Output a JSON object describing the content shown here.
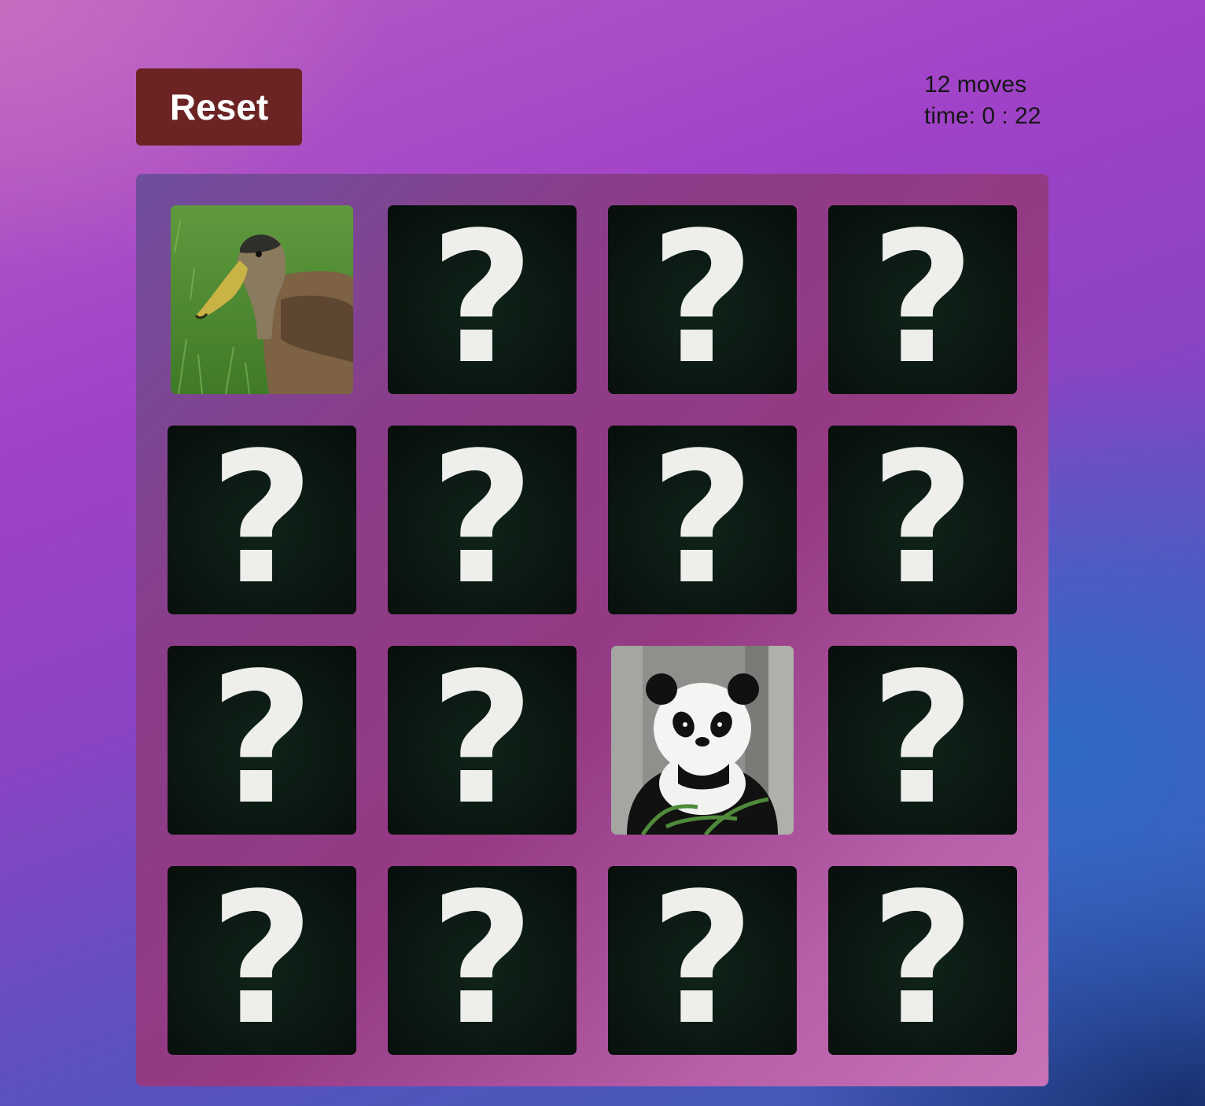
{
  "toolbar": {
    "reset_label": "Reset"
  },
  "stats": {
    "moves": "12 moves",
    "time": "time: 0 : 22"
  },
  "back_glyph": "?",
  "cards": [
    {
      "state": "open",
      "picture": "duck"
    },
    {
      "state": "closed"
    },
    {
      "state": "closed"
    },
    {
      "state": "closed"
    },
    {
      "state": "closed"
    },
    {
      "state": "closed"
    },
    {
      "state": "closed"
    },
    {
      "state": "closed"
    },
    {
      "state": "closed"
    },
    {
      "state": "closed"
    },
    {
      "state": "open",
      "picture": "panda"
    },
    {
      "state": "closed"
    },
    {
      "state": "closed"
    },
    {
      "state": "closed"
    },
    {
      "state": "closed"
    },
    {
      "state": "closed"
    }
  ]
}
